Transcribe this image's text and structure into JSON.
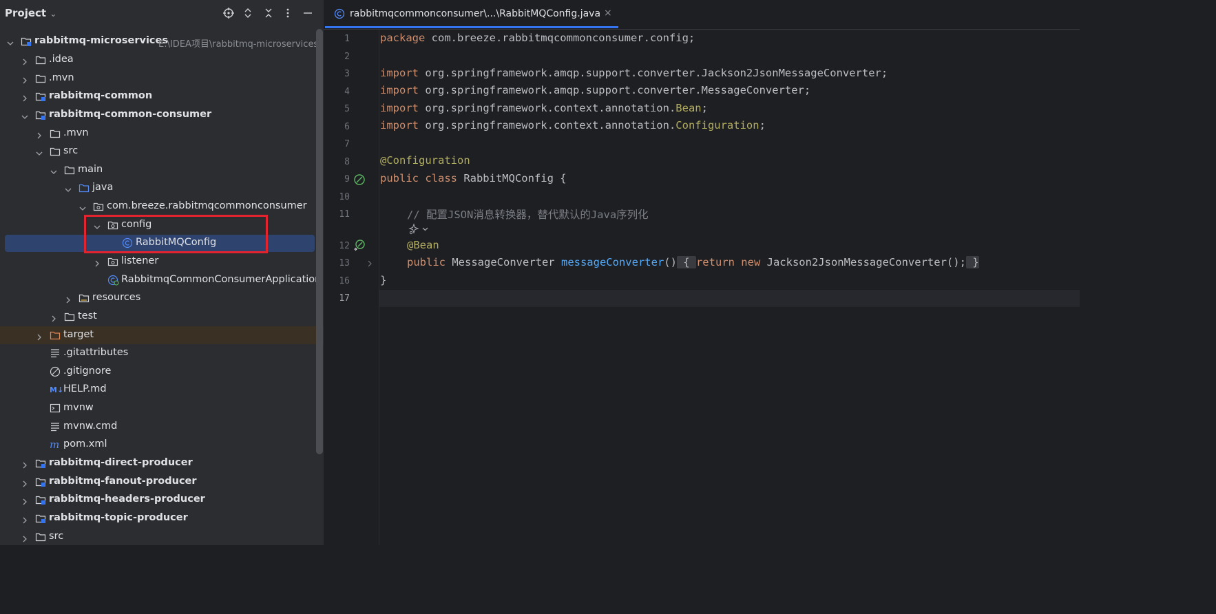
{
  "project_panel": {
    "title": "Project",
    "tree": [
      {
        "label": "rabbitmq-microservices",
        "path": "E:\\IDEA项目\\rabbitmq-microservices",
        "bold": true,
        "icon": "module-folder-icon"
      },
      {
        "label": ".idea",
        "icon": "folder-icon"
      },
      {
        "label": ".mvn",
        "icon": "folder-icon"
      },
      {
        "label": "rabbitmq-common",
        "bold": true,
        "icon": "module-folder-icon"
      },
      {
        "label": "rabbitmq-common-consumer",
        "bold": true,
        "icon": "module-folder-icon"
      },
      {
        "label": ".mvn",
        "icon": "folder-icon"
      },
      {
        "label": "src",
        "icon": "folder-icon"
      },
      {
        "label": "main",
        "icon": "folder-icon"
      },
      {
        "label": "java",
        "icon": "source-folder-icon"
      },
      {
        "label": "com.breeze.rabbitmqcommonconsumer",
        "icon": "package-icon"
      },
      {
        "label": "config",
        "icon": "package-icon"
      },
      {
        "label": "RabbitMQConfig",
        "icon": "class-icon"
      },
      {
        "label": "listener",
        "icon": "package-icon"
      },
      {
        "label": "RabbitmqCommonConsumerApplication",
        "icon": "spring-boot-class-icon"
      },
      {
        "label": "resources",
        "icon": "resources-folder-icon"
      },
      {
        "label": "test",
        "icon": "folder-icon"
      },
      {
        "label": "target",
        "icon": "excluded-folder-icon"
      },
      {
        "label": ".gitattributes",
        "icon": "text-file-icon"
      },
      {
        "label": ".gitignore",
        "icon": "ignore-file-icon"
      },
      {
        "label": "HELP.md",
        "icon": "markdown-file-icon"
      },
      {
        "label": "mvnw",
        "icon": "shell-script-icon"
      },
      {
        "label": "mvnw.cmd",
        "icon": "text-file-icon"
      },
      {
        "label": "pom.xml",
        "icon": "maven-file-icon"
      },
      {
        "label": "rabbitmq-direct-producer",
        "bold": true,
        "icon": "module-folder-icon"
      },
      {
        "label": "rabbitmq-fanout-producer",
        "bold": true,
        "icon": "module-folder-icon"
      },
      {
        "label": "rabbitmq-headers-producer",
        "bold": true,
        "icon": "module-folder-icon"
      },
      {
        "label": "rabbitmq-topic-producer",
        "bold": true,
        "icon": "module-folder-icon"
      },
      {
        "label": "src",
        "icon": "folder-icon"
      }
    ]
  },
  "editor": {
    "tab_label": "rabbitmqcommonconsumer\\...\\RabbitMQConfig.java",
    "tab_close": "×",
    "line_numbers": [
      "1",
      "2",
      "3",
      "4",
      "5",
      "6",
      "7",
      "8",
      "9",
      "10",
      "11",
      "12",
      "13",
      "16",
      "17"
    ],
    "code": {
      "l1_kw": "package",
      "l1_rest": " com.breeze.rabbitmqcommonconsumer.config;",
      "l3_kw": "import",
      "l3_rest": " org.springframework.amqp.support.converter.Jackson2JsonMessageConverter;",
      "l4_kw": "import",
      "l4_rest": " org.springframework.amqp.support.converter.MessageConverter;",
      "l5_kw": "import",
      "l5_rest": " org.springframework.context.annotation.",
      "l5_ann": "Bean",
      "l5_end": ";",
      "l6_kw": "import",
      "l6_rest": " org.springframework.context.annotation.",
      "l6_ann": "Configuration",
      "l6_end": ";",
      "l8_ann": "@Configuration",
      "l9_kw": "public class",
      "l9_rest": " RabbitMQConfig {",
      "l11_comment": "// 配置JSON消息转换器，替代默认的Java序列化",
      "l12_ann": "@Bean",
      "l13_kw": "public",
      "l13_type": " MessageConverter ",
      "l13_fn": "messageConverter",
      "l13_paren": "()",
      "l13_open": " { ",
      "l13_kw2": "return new",
      "l13_call": " Jackson2JsonMessageConverter();",
      "l13_close": " }",
      "l16": "}"
    }
  },
  "colors": {
    "selection": "#2e436e",
    "highlight_box": "#e3232e",
    "keyword": "#cf8e6d",
    "annotation": "#b3ae60",
    "function": "#56a8f5",
    "comment": "#7a7e85"
  }
}
